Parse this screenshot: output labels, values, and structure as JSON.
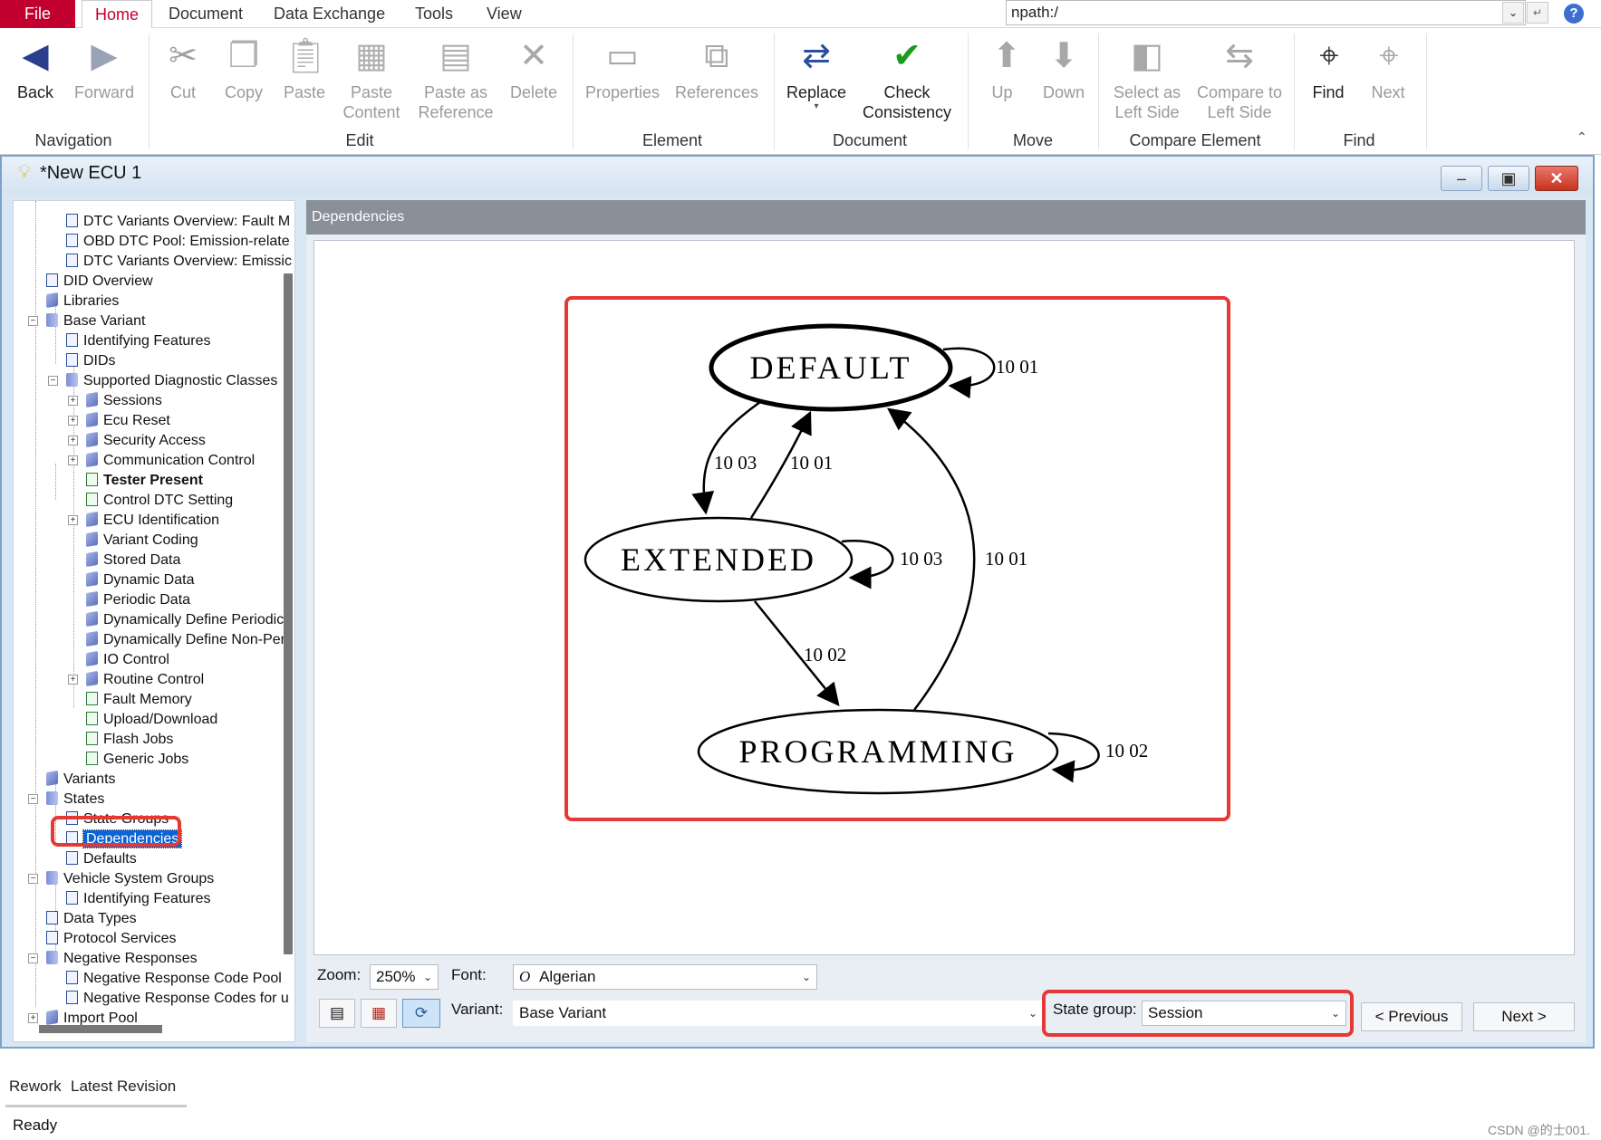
{
  "menubar": {
    "tabs": [
      "File",
      "Home",
      "Document",
      "Data Exchange",
      "Tools",
      "View"
    ],
    "path": "npath:/"
  },
  "ribbon": {
    "groups": {
      "navigation": "Navigation",
      "edit": "Edit",
      "element": "Element",
      "document": "Document",
      "move": "Move",
      "compare": "Compare Element",
      "find": "Find"
    },
    "buttons": {
      "back": "Back",
      "forward": "Forward",
      "cut": "Cut",
      "copy": "Copy",
      "paste": "Paste",
      "paste_content": "Paste Content",
      "paste_ref": "Paste as Reference",
      "delete": "Delete",
      "properties": "Properties",
      "references": "References",
      "replace": "Replace",
      "check": "Check Consistency",
      "up": "Up",
      "down": "Down",
      "select_left": "Select as Left Side",
      "compare_left": "Compare to Left Side",
      "find": "Find",
      "next": "Next"
    }
  },
  "document": {
    "title": "*New ECU 1"
  },
  "tree": {
    "items": [
      "DTC Variants Overview: Fault M",
      "OBD DTC Pool: Emission-relate",
      "DTC Variants Overview: Emissic",
      "DID Overview",
      "Libraries",
      "Base Variant",
      "Identifying Features",
      "DIDs",
      "Supported Diagnostic Classes",
      "Sessions",
      "Ecu Reset",
      "Security Access",
      "Communication Control",
      "Tester Present",
      "Control DTC Setting",
      "ECU Identification",
      "Variant Coding",
      "Stored Data",
      "Dynamic Data",
      "Periodic Data",
      "Dynamically Define Periodic I",
      "Dynamically Define Non-Peri",
      "IO Control",
      "Routine Control",
      "Fault Memory",
      "Upload/Download",
      "Flash Jobs",
      "Generic Jobs",
      "Variants",
      "States",
      "State Groups",
      "Dependencies",
      "Defaults",
      "Vehicle System Groups",
      "Identifying Features",
      "Data Types",
      "Protocol Services",
      "Negative Responses",
      "Negative Response Code Pool",
      "Negative Response Codes for u",
      "Import Pool"
    ]
  },
  "panel": {
    "header": "Dependencies"
  },
  "graph": {
    "nodes": [
      "DEFAULT",
      "EXTENDED",
      "PROGRAMMING"
    ],
    "edges": {
      "default_self": "10 01",
      "default_to_extended": "10 03",
      "extended_to_default": "10 01",
      "extended_self": "10 03",
      "programming_to_default": "10 01",
      "extended_to_programming": "10 02",
      "programming_self": "10 02"
    }
  },
  "controls": {
    "zoom_label": "Zoom:",
    "zoom_value": "250%",
    "font_label": "Font:",
    "font_value": "Algerian",
    "variant_label": "Variant:",
    "variant_value": "Base Variant",
    "state_group_label": "State group:",
    "state_group_value": "Session",
    "previous": "< Previous",
    "next": "Next >"
  },
  "bottom_tabs": [
    "Rework",
    "Latest Revision"
  ],
  "status": {
    "text": "Ready",
    "watermark": "CSDN @的士001."
  },
  "colors": {
    "accent": "#c2002f",
    "highlight": "#e53935",
    "selection": "#0a64d6"
  }
}
